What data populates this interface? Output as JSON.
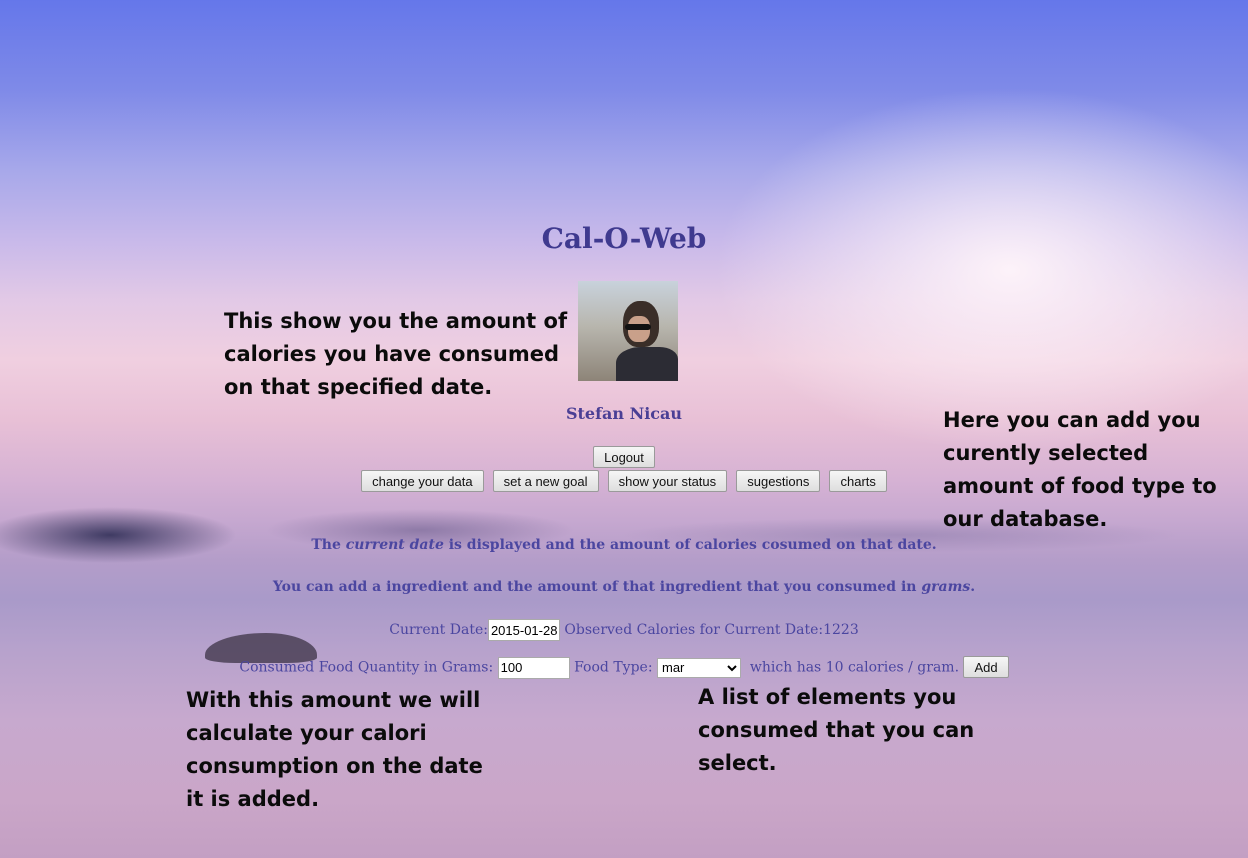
{
  "app": {
    "title": "Cal-O-Web"
  },
  "user": {
    "name": "Stefan Nicau"
  },
  "buttons": {
    "logout": "Logout",
    "change_data": "change your data",
    "new_goal": "set a new goal",
    "status": "show your status",
    "suggestions": "sugestions",
    "charts": "charts",
    "add": "Add"
  },
  "description": {
    "line1_prefix": "The ",
    "line1_em": "current date",
    "line1_suffix": " is displayed and the amount of calories cosumed on that date.",
    "line2_prefix": "You can add a ingredient and the amount of that ingredient that you consumed in ",
    "line2_em": "grams",
    "line2_suffix": "."
  },
  "form": {
    "current_date_label": "Current Date:",
    "current_date_value": "2015-01-28",
    "observed_label": "Observed Calories for Current Date:1223",
    "quantity_label": "Consumed Food Quantity in Grams:",
    "quantity_value": "100",
    "food_type_label": "Food Type:",
    "food_type_selected": "mar",
    "calories_note": "which has 10 calories / gram."
  },
  "annotations": {
    "note1": "This show you the amount of calories you have consumed on that specified date.",
    "note2": "Here you can add you curently selected amount of food type to our database.",
    "note3": "With this amount we will calculate your calori consumption on the date it is added.",
    "note4": "A list of elements you consumed that you can select."
  }
}
